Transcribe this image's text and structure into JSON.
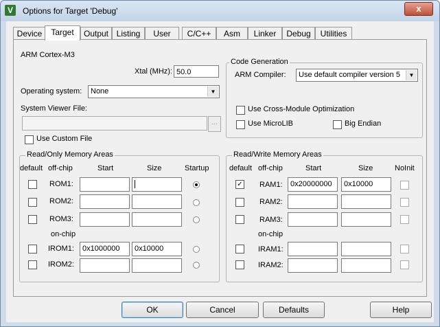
{
  "window": {
    "title": "Options for Target 'Debug'",
    "close_glyph": "x",
    "icon_glyph": "V"
  },
  "tabs": [
    {
      "label": "Device"
    },
    {
      "label": "Target"
    },
    {
      "label": "Output"
    },
    {
      "label": "Listing"
    },
    {
      "label": "User"
    },
    {
      "label": "C/C++"
    },
    {
      "label": "Asm"
    },
    {
      "label": "Linker"
    },
    {
      "label": "Debug"
    },
    {
      "label": "Utilities"
    }
  ],
  "active_tab": "Target",
  "target": {
    "device_name": "ARM Cortex-M3",
    "xtal_label": "Xtal (MHz):",
    "xtal_value": "50.0",
    "os_label": "Operating system:",
    "os_value": "None",
    "svf_label": "System Viewer File:",
    "svf_value": "",
    "browse_glyph": "...",
    "use_custom_file_label": "Use Custom File",
    "use_custom_file": false
  },
  "code_generation": {
    "title": "Code Generation",
    "compiler_label": "ARM Compiler:",
    "compiler_value": "Use default compiler version 5",
    "cross_module_label": "Use Cross-Module Optimization",
    "cross_module": false,
    "microlib_label": "Use MicroLIB",
    "microlib": false,
    "big_endian_label": "Big Endian",
    "big_endian": false
  },
  "ro_memory": {
    "title": "Read/Only Memory Areas",
    "headers": {
      "default": "default",
      "offchip": "off-chip",
      "start": "Start",
      "size": "Size",
      "startup": "Startup"
    },
    "onchip_label": "on-chip",
    "rows": [
      {
        "name": "ROM1:",
        "start": "",
        "size": "",
        "default": false,
        "startup": true
      },
      {
        "name": "ROM2:",
        "start": "",
        "size": "",
        "default": false,
        "startup": false
      },
      {
        "name": "ROM3:",
        "start": "",
        "size": "",
        "default": false,
        "startup": false
      },
      {
        "name": "IROM1:",
        "start": "0x1000000",
        "size": "0x10000",
        "default": false,
        "startup": false
      },
      {
        "name": "IROM2:",
        "start": "",
        "size": "",
        "default": false,
        "startup": false
      }
    ]
  },
  "rw_memory": {
    "title": "Read/Write Memory Areas",
    "headers": {
      "default": "default",
      "offchip": "off-chip",
      "start": "Start",
      "size": "Size",
      "noinit": "NoInit"
    },
    "onchip_label": "on-chip",
    "rows": [
      {
        "name": "RAM1:",
        "start": "0x20000000",
        "size": "0x10000",
        "default": true,
        "noinit": false
      },
      {
        "name": "RAM2:",
        "start": "",
        "size": "",
        "default": false,
        "noinit": false
      },
      {
        "name": "RAM3:",
        "start": "",
        "size": "",
        "default": false,
        "noinit": false
      },
      {
        "name": "IRAM1:",
        "start": "",
        "size": "",
        "default": false,
        "noinit": false
      },
      {
        "name": "IRAM2:",
        "start": "",
        "size": "",
        "default": false,
        "noinit": false
      }
    ]
  },
  "buttons": {
    "ok": "OK",
    "cancel": "Cancel",
    "defaults": "Defaults",
    "help": "Help"
  },
  "check_glyph": "✓",
  "dropdown_glyph": "▼"
}
